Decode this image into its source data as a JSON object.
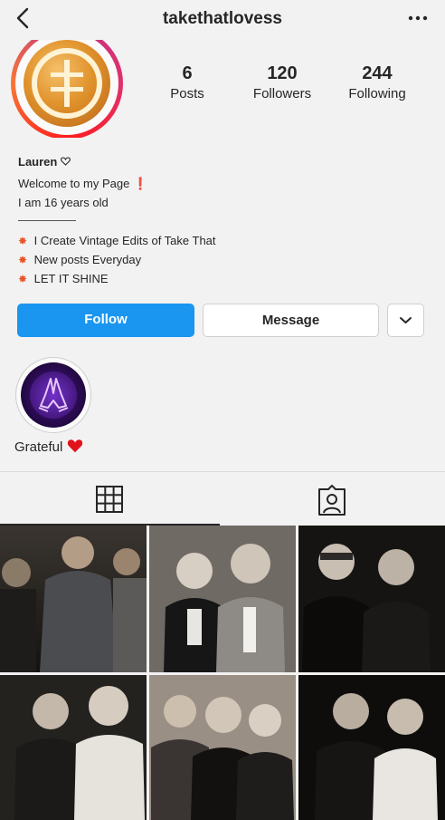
{
  "header": {
    "username": "takethatlovess"
  },
  "stats": [
    {
      "value": "6",
      "label": "Posts"
    },
    {
      "value": "120",
      "label": "Followers"
    },
    {
      "value": "244",
      "label": "Following"
    }
  ],
  "profile": {
    "name": "Lauren",
    "bio": {
      "line1": "Welcome to my Page",
      "line2": "I am 16 years old",
      "item1": "I Create Vintage Edits of Take That",
      "item2": "New posts Everyday",
      "item3": "LET IT SHINE"
    }
  },
  "buttons": {
    "follow": "Follow",
    "message": "Message"
  },
  "highlight": {
    "label": "Grateful"
  },
  "colors": {
    "follow_blue": "#1a95f0",
    "story_ring": "#e1306c",
    "heart": "#e0121b"
  },
  "icons": [
    "back-arrow-icon",
    "more-icon",
    "heart-outline-icon",
    "exclamation-icon",
    "sparkle-icon",
    "chevron-down-icon",
    "praying-hands-icon",
    "red-heart-icon",
    "grid-icon",
    "tagged-icon"
  ]
}
